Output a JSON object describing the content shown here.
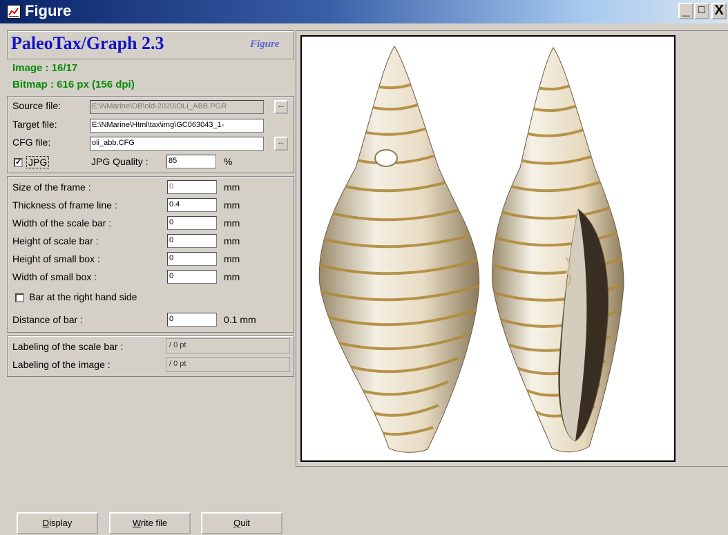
{
  "window": {
    "title": "Figure",
    "buttons": {
      "minimize": "_",
      "maximize": "□",
      "close": "X"
    }
  },
  "header": {
    "app_title": "PaleoTax/Graph 2.3",
    "figure_label": "Figure",
    "image_info": "Image : 16/17",
    "bitmap_info": "Bitmap : 616 px (156 dpi)"
  },
  "files": {
    "source_label": "Source file:",
    "source_value": "E:\\NMarine\\DB\\old-2020\\OLI_ABB.PGR",
    "target_label": "Target file:",
    "target_value": "E:\\NMarine\\Html\\tax\\img\\GC063043_1-",
    "cfg_label": "CFG file:",
    "cfg_value": "oli_abb.CFG",
    "browse_label": "...",
    "jpg_label": "JPG",
    "jpg_checked": true,
    "jpg_quality_label": "JPG Quality :",
    "jpg_quality_value": "85",
    "jpg_quality_unit": "%"
  },
  "frame_settings": {
    "size_label": "Size of the frame :",
    "size_value": "0",
    "thickness_label": "Thickness of frame line :",
    "thickness_value": "0.4",
    "scale_width_label": "Width of the scale bar :",
    "scale_width_value": "0",
    "scale_height_label": "Height of scale bar :",
    "scale_height_value": "0",
    "small_height_label": "Height of small box :",
    "small_height_value": "0",
    "small_width_label": "Width of small box :",
    "small_width_value": "0",
    "unit_mm": "mm",
    "bar_right_label": "Bar at the right hand side",
    "bar_right_checked": false,
    "distance_label": "Distance of bar  :",
    "distance_value": "0",
    "distance_unit": "0.1 mm"
  },
  "labeling": {
    "scale_bar_label": "Labeling of the scale bar :",
    "scale_bar_value": "/ 0 pt",
    "image_label": "Labeling of the image :",
    "image_value": "/ 0 pt"
  },
  "actions": {
    "display_first": "D",
    "display_rest": "isplay",
    "write_first": "W",
    "write_rest": "rite file",
    "quit_first": "Q",
    "quit_rest": "uit"
  },
  "colors": {
    "title_blue": "#0a246a",
    "app_title": "#1414c8",
    "info_green": "#0a8a0a",
    "face": "#d4d0c8"
  }
}
